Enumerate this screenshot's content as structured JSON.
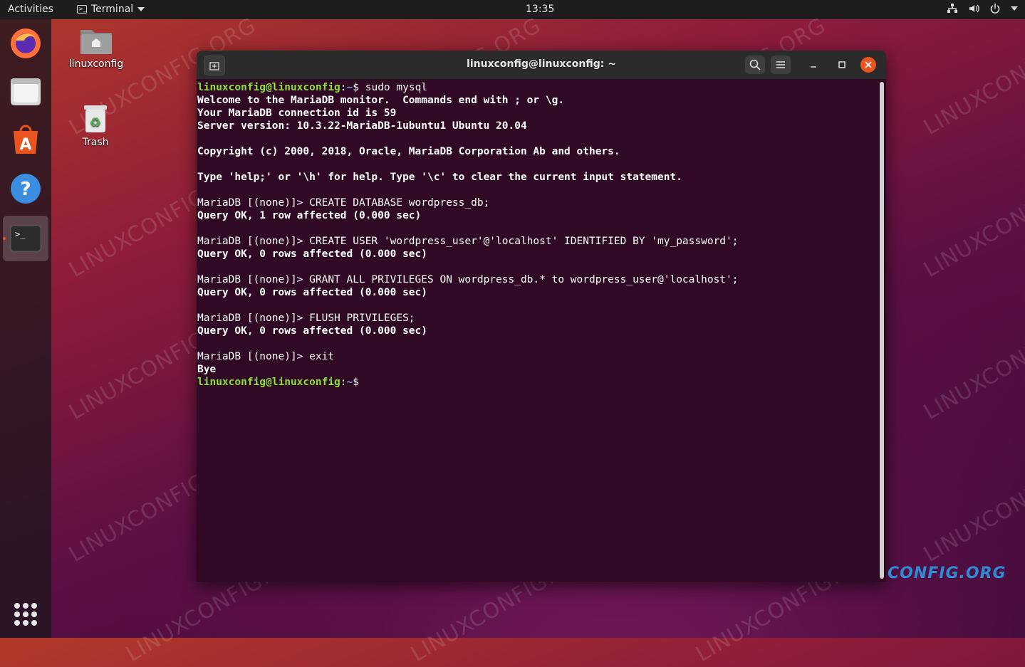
{
  "topbar": {
    "activities": "Activities",
    "app_name": "Terminal",
    "clock": "13:35"
  },
  "desktop": {
    "home_label": "linuxconfig",
    "trash_label": "Trash",
    "watermark": "LINUXCONFIG.ORG",
    "brand_text": "CONFIG.ORG"
  },
  "dock": {
    "items": [
      "firefox-icon",
      "files-icon",
      "software-icon",
      "help-icon",
      "terminal-icon"
    ]
  },
  "window": {
    "title": "linuxconfig@linuxconfig: ~"
  },
  "terminal": {
    "prompt_user": "linuxconfig@linuxconfig",
    "prompt_sep": ":",
    "prompt_path": "~",
    "prompt_end": "$ ",
    "first_command": "sudo mysql",
    "lines": [
      "Welcome to the MariaDB monitor.  Commands end with ; or \\g.",
      "Your MariaDB connection id is 59",
      "Server version: 10.3.22-MariaDB-1ubuntu1 Ubuntu 20.04",
      "",
      "Copyright (c) 2000, 2018, Oracle, MariaDB Corporation Ab and others.",
      "",
      "Type 'help;' or '\\h' for help. Type '\\c' to clear the current input statement.",
      "",
      "MariaDB [(none)]> CREATE DATABASE wordpress_db;",
      "Query OK, 1 row affected (0.000 sec)",
      "",
      "MariaDB [(none)]> CREATE USER 'wordpress_user'@'localhost' IDENTIFIED BY 'my_password';",
      "Query OK, 0 rows affected (0.000 sec)",
      "",
      "MariaDB [(none)]> GRANT ALL PRIVILEGES ON wordpress_db.* to wordpress_user@'localhost';",
      "Query OK, 0 rows affected (0.000 sec)",
      "",
      "MariaDB [(none)]> FLUSH PRIVILEGES;",
      "Query OK, 0 rows affected (0.000 sec)",
      "",
      "MariaDB [(none)]> exit",
      "Bye"
    ],
    "bold_lines": [
      0,
      1,
      2,
      4,
      6,
      9,
      12,
      15,
      18,
      21
    ]
  },
  "colors": {
    "terminal_bg": "#300a24",
    "prompt_user": "#8ae234",
    "prompt_path": "#729fcf",
    "accent": "#e95420"
  }
}
